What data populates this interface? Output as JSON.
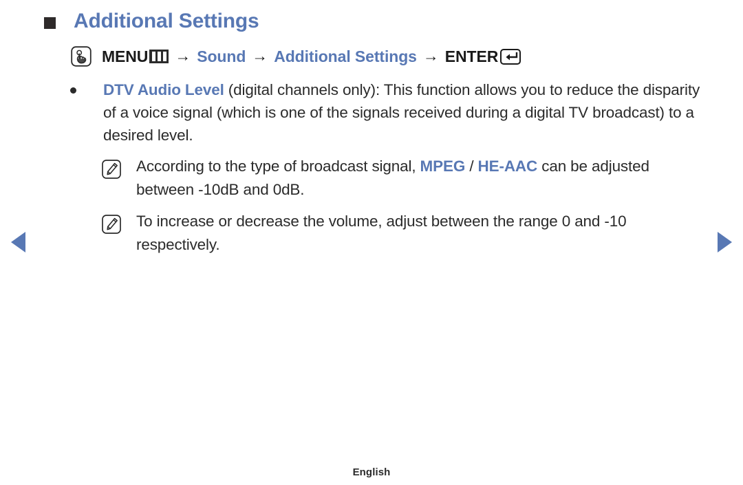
{
  "page": {
    "title": "Additional Settings",
    "footer_language": "English"
  },
  "menu_path": {
    "touch_icon": "touch-hand-icon",
    "menu_label": "MENU",
    "menu_icon": "menu-bars-icon",
    "arrow": "→",
    "step_sound": "Sound",
    "step_additional_settings": "Additional Settings",
    "enter_label": "ENTER",
    "enter_icon": "enter-return-icon"
  },
  "content": {
    "bullet": {
      "marker": "bullet-dot",
      "highlight": "DTV Audio Level",
      "text": " (digital channels only): This function allows you to reduce the disparity of a voice signal (which is one of the signals received during a digital TV broadcast) to a desired level."
    },
    "notes": [
      {
        "icon": "note-pen-icon",
        "text_before": "According to the type of broadcast signal, ",
        "highlight_1": "MPEG",
        "separator": " / ",
        "highlight_2": "HE-AAC",
        "text_after": " can be adjusted between -10dB and 0dB."
      },
      {
        "icon": "note-pen-icon",
        "text_before": "To increase or decrease the volume, adjust between the range 0 and -10 respectively.",
        "highlight_1": "",
        "separator": "",
        "highlight_2": "",
        "text_after": ""
      }
    ]
  },
  "navigation": {
    "prev_label": "previous-page",
    "next_label": "next-page"
  },
  "colors": {
    "accent_blue": "#5878b4",
    "text_dark": "#2b2b2b"
  }
}
